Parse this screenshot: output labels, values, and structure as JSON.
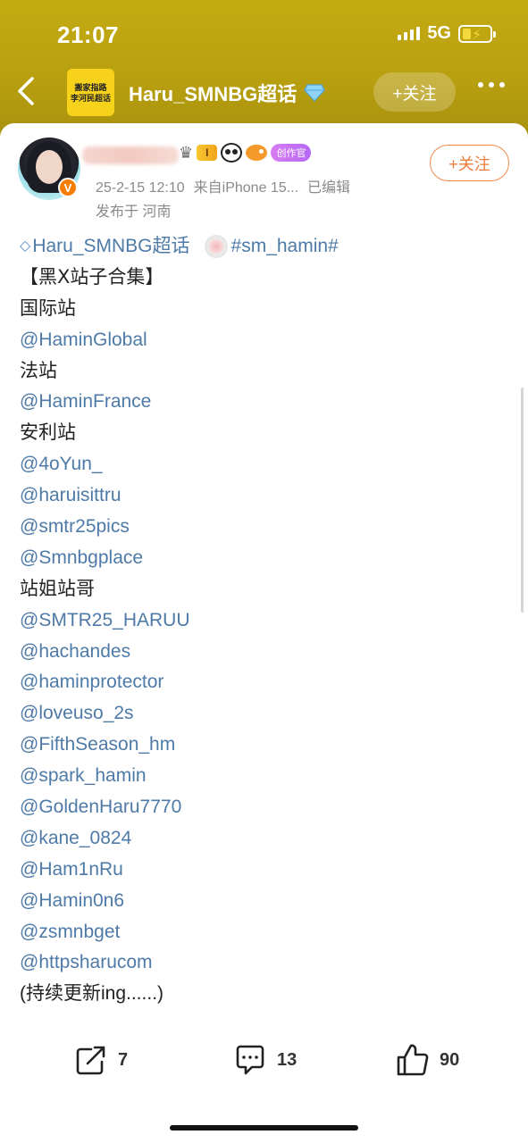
{
  "status_bar": {
    "time": "21:07",
    "network": "5G"
  },
  "header": {
    "logo_line1": "搬家指路",
    "logo_line2": "李河民超话",
    "title": "Haru_SMNBG超话",
    "follow_label": "+关注"
  },
  "post": {
    "badge_level": "I",
    "badge_creator": "创作官",
    "timestamp": "25-2-15 12:10",
    "source": "来自iPhone 15...",
    "edited": "已编辑",
    "location": "发布于 河南",
    "follow_label": "+关注",
    "topic_link": "Haru_SMNBG超话",
    "hashtag": "#sm_hamin#",
    "lines": [
      {
        "text": "【黑Ⅹ站子合集】",
        "link": false
      },
      {
        "text": "国际站",
        "link": false
      },
      {
        "text": "@HaminGlobal",
        "link": true
      },
      {
        "text": "法站",
        "link": false
      },
      {
        "text": "@HaminFrance",
        "link": true
      },
      {
        "text": "安利站",
        "link": false
      },
      {
        "text": "@4oYun_",
        "link": true
      },
      {
        "text": "@haruisittru",
        "link": true
      },
      {
        "text": "@smtr25pics",
        "link": true
      },
      {
        "text": "@Smnbgplace",
        "link": true
      },
      {
        "text": "站姐站哥",
        "link": false
      },
      {
        "text": "@SMTR25_HARUU",
        "link": true
      },
      {
        "text": "@hachandes",
        "link": true
      },
      {
        "text": "@haminprotector",
        "link": true
      },
      {
        "text": "@loveuso_2s",
        "link": true
      },
      {
        "text": "@FifthSeason_hm",
        "link": true
      },
      {
        "text": "@spark_hamin",
        "link": true
      },
      {
        "text": "@GoldenHaru7770",
        "link": true
      },
      {
        "text": "@kane_0824",
        "link": true
      },
      {
        "text": "@Ham1nRu",
        "link": true
      },
      {
        "text": "@Hamin0n6",
        "link": true
      },
      {
        "text": "@zsmnbget",
        "link": true
      },
      {
        "text": "@httpsharucom",
        "link": true
      },
      {
        "text": "(持续更新ing......)",
        "link": false
      }
    ]
  },
  "actions": {
    "share_count": "7",
    "comment_count": "13",
    "like_count": "90"
  },
  "colors": {
    "link": "#4e7aa8",
    "header": "#b9a40e",
    "follow": "#f07b3a"
  }
}
